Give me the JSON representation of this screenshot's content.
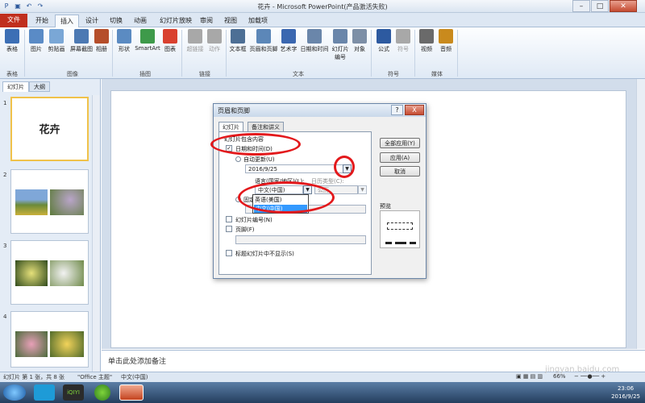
{
  "window": {
    "title": "花卉 - Microsoft PowerPoint(产品激活失败)"
  },
  "tabs": [
    "文件",
    "开始",
    "插入",
    "设计",
    "切换",
    "动画",
    "幻灯片放映",
    "审阅",
    "视图",
    "加载项"
  ],
  "ribbon": {
    "buttons": [
      {
        "label": "表格",
        "color": "#3c6fb5"
      },
      {
        "label": "图片",
        "color": "#5a8bc6"
      },
      {
        "label": "剪贴画",
        "color": "#7aa7d6"
      },
      {
        "label": "屏幕截图",
        "color": "#4c79b3"
      },
      {
        "label": "相册",
        "color": "#b54e2a"
      },
      {
        "label": "形状",
        "color": "#5b8bc2"
      },
      {
        "label": "SmartArt",
        "color": "#3e9a4a"
      },
      {
        "label": "图表",
        "color": "#d9412f"
      },
      {
        "label": "超链接",
        "color": "#a8a8a8"
      },
      {
        "label": "动作",
        "color": "#a8a8a8"
      },
      {
        "label": "文本框",
        "color": "#4d6f95"
      },
      {
        "label": "页眉和页脚",
        "color": "#5c87b8"
      },
      {
        "label": "艺术字",
        "color": "#3a67b0"
      },
      {
        "label": "日期和时间",
        "color": "#6a86aa"
      },
      {
        "label": "幻灯片\n编号",
        "color": "#6a86aa"
      },
      {
        "label": "对象",
        "color": "#7d8fa6"
      },
      {
        "label": "公式",
        "color": "#2d5aa0"
      },
      {
        "label": "符号",
        "color": "#a8a8a8"
      },
      {
        "label": "视频",
        "color": "#6a6a6a"
      },
      {
        "label": "音频",
        "color": "#c98a1d"
      }
    ],
    "groups": [
      "表格",
      "图像",
      "插图",
      "链接",
      "文本",
      "符号",
      "媒体"
    ]
  },
  "left_panel": {
    "tabs": [
      "幻灯片",
      "大纲"
    ],
    "slide_numbers": [
      "1",
      "2",
      "3",
      "4"
    ],
    "slide1_title": "花卉"
  },
  "notes": {
    "placeholder": "单击此处添加备注"
  },
  "status": {
    "slide_info": "幻灯片 第 1 张，共 8 张",
    "theme": "\"Office 主题\"",
    "language": "中文(中国)",
    "zoom": "66%"
  },
  "taskbar": {
    "time": "23:06",
    "date": "2016/9/25",
    "iqiyi": "iQIYI"
  },
  "dialog": {
    "title": "页眉和页脚",
    "help": "?",
    "close": "X",
    "tabs": [
      "幻灯片",
      "备注和讲义"
    ],
    "section_label": "幻灯片包含内容",
    "datetime_label": "日期和时间(D)",
    "auto_update_label": "自动更新(U)",
    "date_value": "2016/9/25",
    "language_label": "语言(国家/地区)(L):",
    "calendar_label": "日历类型(C):",
    "language_value": "中文(中国)",
    "calendar_value": "公历",
    "fixed_label": "固定(X)",
    "language_options": [
      "英语(美国)",
      "中文(中国)"
    ],
    "slide_number_label": "幻灯片编号(N)",
    "footer_label": "页脚(F)",
    "hide_title_label": "标题幻灯片中不显示(S)",
    "buttons": {
      "apply_all": "全部应用(Y)",
      "apply": "应用(A)",
      "cancel": "取消"
    },
    "preview_label": "预览",
    "datetime_checked": "✓"
  },
  "watermark": "jingyan.baidu.com"
}
